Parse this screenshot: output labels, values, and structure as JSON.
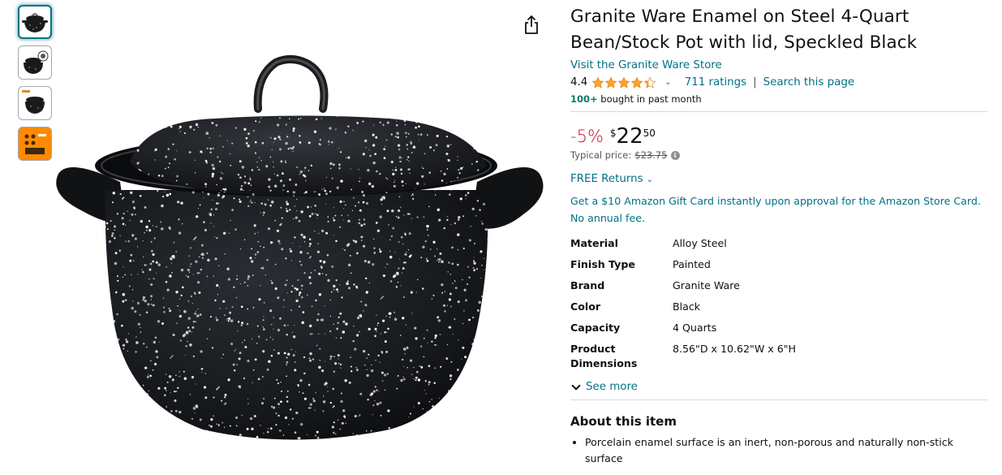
{
  "thumbnails": [
    {
      "name": "pot-front-view",
      "selected": true
    },
    {
      "name": "pot-with-badge",
      "selected": false
    },
    {
      "name": "pot-with-label",
      "selected": false
    },
    {
      "name": "orange-infographic",
      "selected": false
    }
  ],
  "product": {
    "title": "Granite Ware Enamel on Steel 4-Quart Bean/Stock Pot with lid, Speckled Black",
    "store_link": "Visit the Granite Ware Store",
    "rating": "4.4",
    "stars_value": 4.4,
    "ratings_count": "711 ratings",
    "search_page": "Search this page",
    "bought_bold": "100+",
    "bought_rest": " bought in past month"
  },
  "price": {
    "discount": "-5%",
    "currency": "$",
    "whole": "22",
    "fraction": "50",
    "typical_label": "Typical price:",
    "typical_value": "$23.75"
  },
  "returns": "FREE Returns",
  "promo": "Get a $10 Amazon Gift Card instantly upon approval for the Amazon Store Card. No annual fee.",
  "specs": [
    {
      "k": "Material",
      "v": "Alloy Steel"
    },
    {
      "k": "Finish Type",
      "v": "Painted"
    },
    {
      "k": "Brand",
      "v": "Granite Ware"
    },
    {
      "k": "Color",
      "v": "Black"
    },
    {
      "k": "Capacity",
      "v": "4 Quarts"
    },
    {
      "k": "Product Dimensions",
      "v": "8.56\"D x 10.62\"W x 6\"H"
    }
  ],
  "see_more": "See more",
  "about": {
    "heading": "About this item",
    "bullets": [
      "Porcelain enamel surface is an inert, non-porous and naturally non-stick surface"
    ]
  },
  "colors": {
    "link": "#007185",
    "discount": "#cc0c39",
    "star": "#ffa41c",
    "bought": "#067d62"
  },
  "icons": {
    "share": "share-icon",
    "info": "info-icon",
    "chevron": "chevron-down-icon",
    "star": "star-icon"
  }
}
